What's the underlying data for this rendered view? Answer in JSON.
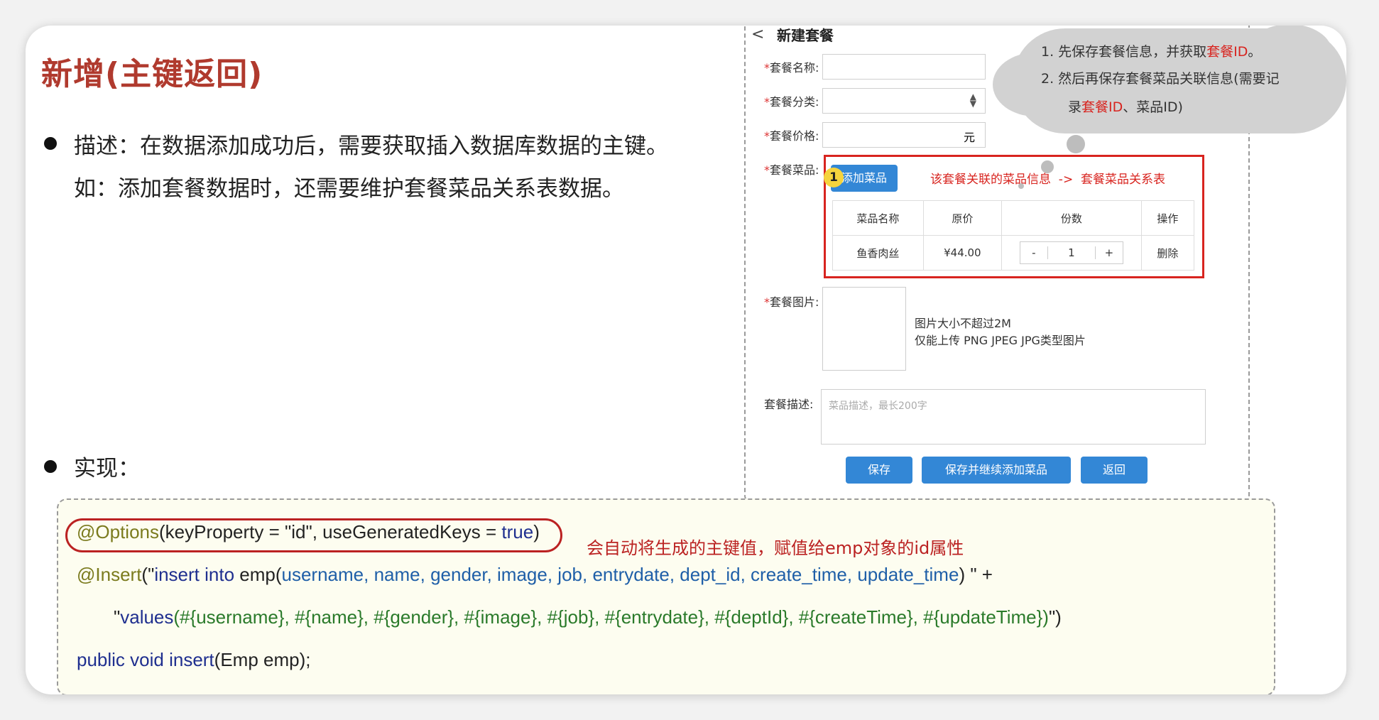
{
  "slide": {
    "title": "新增(主键返回)",
    "desc_line1": "描述：在数据添加成功后，需要获取插入数据库数据的主键。",
    "desc_line2": "如：添加套餐数据时，还需要维护套餐菜品关系表数据。",
    "impl_label": "实现："
  },
  "form": {
    "back": "<",
    "title": "新建套餐",
    "label_name": "套餐名称:",
    "label_category": "套餐分类:",
    "label_price": "套餐价格:",
    "price_unit": "元",
    "label_dishes": "套餐菜品:",
    "add_dish_button": "添加菜品",
    "relation_note": "该套餐关联的菜品信息  ->  套餐菜品关系表",
    "step_badge": "1",
    "table": {
      "headers": [
        "菜品名称",
        "原价",
        "份数",
        "操作"
      ],
      "rows": [
        {
          "name": "鱼香肉丝",
          "price": "¥44.00",
          "qty_minus": "-",
          "qty": "1",
          "qty_plus": "+",
          "action": "删除"
        }
      ]
    },
    "label_image": "套餐图片:",
    "image_hint1": "图片大小不超过2M",
    "image_hint2": "仅能上传 PNG JPEG JPG类型图片",
    "label_desc": "套餐描述:",
    "desc_placeholder": "菜品描述，最长200字",
    "save_button": "保存",
    "save_continue_button": "保存并继续添加菜品",
    "back_button": "返回"
  },
  "cloud": {
    "line1_pre": "1.   先保存套餐信息，并获取",
    "line1_red": "套餐ID",
    "line1_post": "。",
    "line2": "2.   然后再保存套餐菜品关联信息(需要记",
    "line3_pre": "录",
    "line3_red": "套餐ID",
    "line3_post": "、菜品ID)"
  },
  "code": {
    "line1": {
      "ann": "@Options",
      "rest": "(keyProperty = \"id\", useGeneratedKeys = ",
      "kw": "true",
      "close": ")"
    },
    "note": "会自动将生成的主键值，赋值给emp对象的id属性",
    "line2": {
      "ann": "@Insert",
      "open": "(\"",
      "sql1": "insert into",
      "sql2": " emp(",
      "cols": "username, name, gender, image, job, entrydate, dept_id, create_time, update_time",
      "close": ") \" +"
    },
    "line3": {
      "open": "\"",
      "kw": "values",
      "vals": "(#{username}, #{name}, #{gender}, #{image}, #{job}, #{entrydate}, #{deptId}, #{createTime}, #{updateTime})",
      "close": "\")"
    },
    "line4": {
      "kw": "public void insert",
      "rest": "(Emp emp);"
    }
  }
}
